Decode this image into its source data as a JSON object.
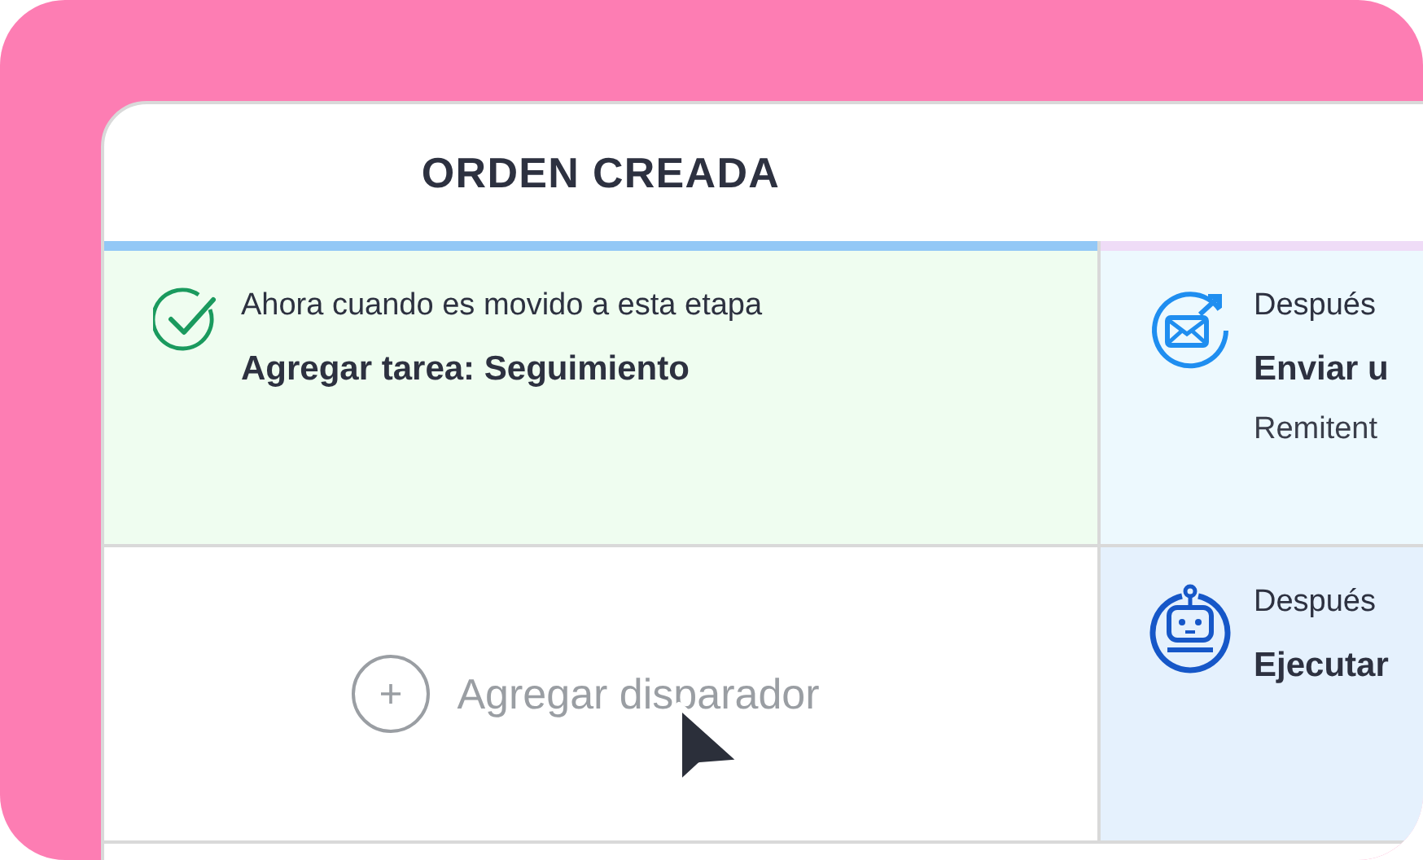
{
  "stages": [
    {
      "title": "ORDEN CREADA",
      "color": "#93c8f6"
    },
    {
      "color": "#efdcf7"
    }
  ],
  "rows": [
    {
      "trigger": {
        "kind": "done",
        "caption": "Ahora cuando es movido a esta etapa",
        "action": "Agregar tarea: Seguimiento"
      },
      "next": {
        "kind": "email",
        "caption": "Después",
        "action": "Enviar u",
        "detail": "Remitent"
      }
    },
    {
      "trigger": {
        "kind": "add",
        "label": "Agregar disparador"
      },
      "next": {
        "kind": "robot",
        "caption": "Después",
        "action": "Ejecutar"
      }
    }
  ]
}
